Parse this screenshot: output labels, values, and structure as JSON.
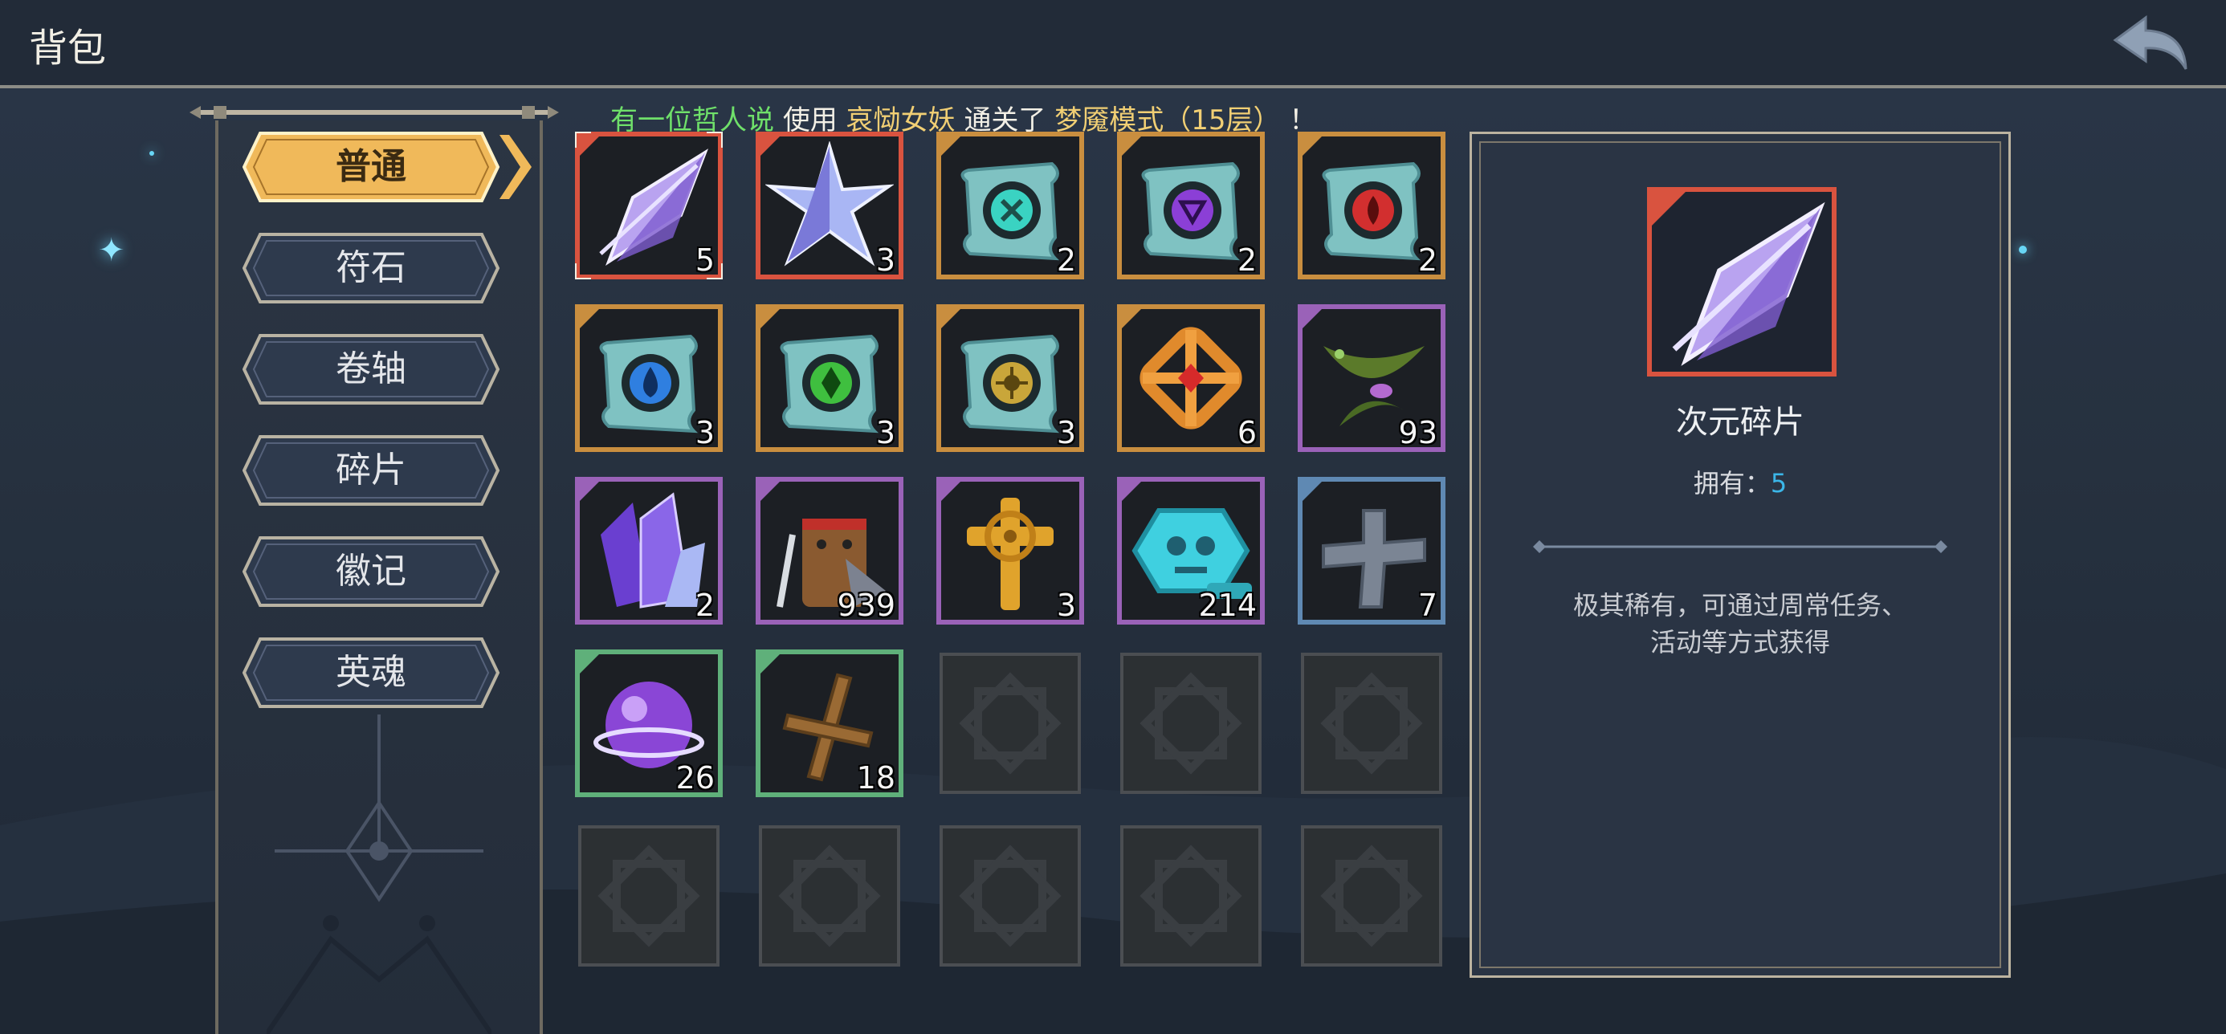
{
  "header": {
    "title": "背包",
    "back_icon": "back-arrow-icon"
  },
  "marquee": {
    "player": "有一位哲人说",
    "verb1": "使用",
    "hero": "哀恸女妖",
    "verb2": "通关了",
    "mode": "梦魇模式（15层）",
    "end": "！"
  },
  "tabs": [
    {
      "label": "普通",
      "active": true
    },
    {
      "label": "符石",
      "active": false
    },
    {
      "label": "卷轴",
      "active": false
    },
    {
      "label": "碎片",
      "active": false
    },
    {
      "label": "徽记",
      "active": false
    },
    {
      "label": "英魂",
      "active": false
    }
  ],
  "inventory": [
    {
      "icon": "crystal-feather-icon",
      "count": "5",
      "rarity": "red",
      "selected": true
    },
    {
      "icon": "crystal-star-icon",
      "count": "3",
      "rarity": "red"
    },
    {
      "icon": "teal-rune-scroll-icon",
      "count": "2",
      "rarity": "orange"
    },
    {
      "icon": "purple-rune-scroll-icon",
      "count": "2",
      "rarity": "orange"
    },
    {
      "icon": "red-rune-scroll-icon",
      "count": "2",
      "rarity": "orange"
    },
    {
      "icon": "water-rune-scroll-icon",
      "count": "3",
      "rarity": "orange"
    },
    {
      "icon": "leaf-rune-scroll-icon",
      "count": "3",
      "rarity": "orange"
    },
    {
      "icon": "sun-rune-scroll-icon",
      "count": "3",
      "rarity": "orange"
    },
    {
      "icon": "orange-wheel-amulet-icon",
      "count": "6",
      "rarity": "orange"
    },
    {
      "icon": "green-leaf-charm-icon",
      "count": "93",
      "rarity": "purple"
    },
    {
      "icon": "purple-crystal-cluster-icon",
      "count": "2",
      "rarity": "purple"
    },
    {
      "icon": "stump-warrior-icon",
      "count": "939",
      "rarity": "purple"
    },
    {
      "icon": "golden-cross-icon",
      "count": "3",
      "rarity": "purple"
    },
    {
      "icon": "cyan-skull-coin-icon",
      "count": "214",
      "rarity": "purple"
    },
    {
      "icon": "stone-cross-icon",
      "count": "7",
      "rarity": "blue"
    },
    {
      "icon": "purple-orb-icon",
      "count": "26",
      "rarity": "green"
    },
    {
      "icon": "wooden-cross-icon",
      "count": "18",
      "rarity": "green"
    }
  ],
  "empty_slot_count": 8,
  "detail": {
    "icon": "crystal-feather-icon",
    "name": "次元碎片",
    "owned_label": "拥有：",
    "owned_value": "5",
    "desc_line1": "极其稀有，可通过周常任务、",
    "desc_line2": "活动等方式获得"
  },
  "colors": {
    "red": "#d9533f",
    "orange": "#c98e3f",
    "purple": "#9a62b8",
    "blue": "#5f89b3",
    "green": "#5fb07a",
    "accent": "#3bb6e8",
    "tab_active": "#f0b95a"
  }
}
